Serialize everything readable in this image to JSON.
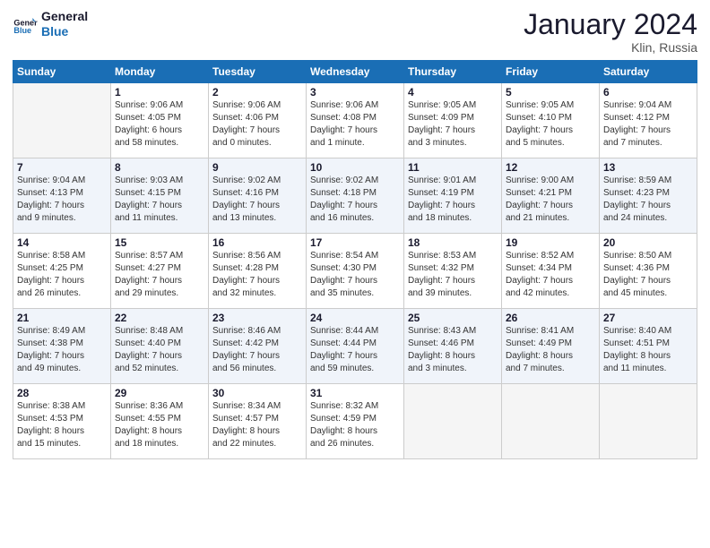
{
  "logo": {
    "line1": "General",
    "line2": "Blue"
  },
  "title": "January 2024",
  "location": "Klin, Russia",
  "days_header": [
    "Sunday",
    "Monday",
    "Tuesday",
    "Wednesday",
    "Thursday",
    "Friday",
    "Saturday"
  ],
  "weeks": [
    [
      {
        "num": "",
        "detail": ""
      },
      {
        "num": "1",
        "detail": "Sunrise: 9:06 AM\nSunset: 4:05 PM\nDaylight: 6 hours\nand 58 minutes."
      },
      {
        "num": "2",
        "detail": "Sunrise: 9:06 AM\nSunset: 4:06 PM\nDaylight: 7 hours\nand 0 minutes."
      },
      {
        "num": "3",
        "detail": "Sunrise: 9:06 AM\nSunset: 4:08 PM\nDaylight: 7 hours\nand 1 minute."
      },
      {
        "num": "4",
        "detail": "Sunrise: 9:05 AM\nSunset: 4:09 PM\nDaylight: 7 hours\nand 3 minutes."
      },
      {
        "num": "5",
        "detail": "Sunrise: 9:05 AM\nSunset: 4:10 PM\nDaylight: 7 hours\nand 5 minutes."
      },
      {
        "num": "6",
        "detail": "Sunrise: 9:04 AM\nSunset: 4:12 PM\nDaylight: 7 hours\nand 7 minutes."
      }
    ],
    [
      {
        "num": "7",
        "detail": "Sunrise: 9:04 AM\nSunset: 4:13 PM\nDaylight: 7 hours\nand 9 minutes."
      },
      {
        "num": "8",
        "detail": "Sunrise: 9:03 AM\nSunset: 4:15 PM\nDaylight: 7 hours\nand 11 minutes."
      },
      {
        "num": "9",
        "detail": "Sunrise: 9:02 AM\nSunset: 4:16 PM\nDaylight: 7 hours\nand 13 minutes."
      },
      {
        "num": "10",
        "detail": "Sunrise: 9:02 AM\nSunset: 4:18 PM\nDaylight: 7 hours\nand 16 minutes."
      },
      {
        "num": "11",
        "detail": "Sunrise: 9:01 AM\nSunset: 4:19 PM\nDaylight: 7 hours\nand 18 minutes."
      },
      {
        "num": "12",
        "detail": "Sunrise: 9:00 AM\nSunset: 4:21 PM\nDaylight: 7 hours\nand 21 minutes."
      },
      {
        "num": "13",
        "detail": "Sunrise: 8:59 AM\nSunset: 4:23 PM\nDaylight: 7 hours\nand 24 minutes."
      }
    ],
    [
      {
        "num": "14",
        "detail": "Sunrise: 8:58 AM\nSunset: 4:25 PM\nDaylight: 7 hours\nand 26 minutes."
      },
      {
        "num": "15",
        "detail": "Sunrise: 8:57 AM\nSunset: 4:27 PM\nDaylight: 7 hours\nand 29 minutes."
      },
      {
        "num": "16",
        "detail": "Sunrise: 8:56 AM\nSunset: 4:28 PM\nDaylight: 7 hours\nand 32 minutes."
      },
      {
        "num": "17",
        "detail": "Sunrise: 8:54 AM\nSunset: 4:30 PM\nDaylight: 7 hours\nand 35 minutes."
      },
      {
        "num": "18",
        "detail": "Sunrise: 8:53 AM\nSunset: 4:32 PM\nDaylight: 7 hours\nand 39 minutes."
      },
      {
        "num": "19",
        "detail": "Sunrise: 8:52 AM\nSunset: 4:34 PM\nDaylight: 7 hours\nand 42 minutes."
      },
      {
        "num": "20",
        "detail": "Sunrise: 8:50 AM\nSunset: 4:36 PM\nDaylight: 7 hours\nand 45 minutes."
      }
    ],
    [
      {
        "num": "21",
        "detail": "Sunrise: 8:49 AM\nSunset: 4:38 PM\nDaylight: 7 hours\nand 49 minutes."
      },
      {
        "num": "22",
        "detail": "Sunrise: 8:48 AM\nSunset: 4:40 PM\nDaylight: 7 hours\nand 52 minutes."
      },
      {
        "num": "23",
        "detail": "Sunrise: 8:46 AM\nSunset: 4:42 PM\nDaylight: 7 hours\nand 56 minutes."
      },
      {
        "num": "24",
        "detail": "Sunrise: 8:44 AM\nSunset: 4:44 PM\nDaylight: 7 hours\nand 59 minutes."
      },
      {
        "num": "25",
        "detail": "Sunrise: 8:43 AM\nSunset: 4:46 PM\nDaylight: 8 hours\nand 3 minutes."
      },
      {
        "num": "26",
        "detail": "Sunrise: 8:41 AM\nSunset: 4:49 PM\nDaylight: 8 hours\nand 7 minutes."
      },
      {
        "num": "27",
        "detail": "Sunrise: 8:40 AM\nSunset: 4:51 PM\nDaylight: 8 hours\nand 11 minutes."
      }
    ],
    [
      {
        "num": "28",
        "detail": "Sunrise: 8:38 AM\nSunset: 4:53 PM\nDaylight: 8 hours\nand 15 minutes."
      },
      {
        "num": "29",
        "detail": "Sunrise: 8:36 AM\nSunset: 4:55 PM\nDaylight: 8 hours\nand 18 minutes."
      },
      {
        "num": "30",
        "detail": "Sunrise: 8:34 AM\nSunset: 4:57 PM\nDaylight: 8 hours\nand 22 minutes."
      },
      {
        "num": "31",
        "detail": "Sunrise: 8:32 AM\nSunset: 4:59 PM\nDaylight: 8 hours\nand 26 minutes."
      },
      {
        "num": "",
        "detail": ""
      },
      {
        "num": "",
        "detail": ""
      },
      {
        "num": "",
        "detail": ""
      }
    ]
  ]
}
